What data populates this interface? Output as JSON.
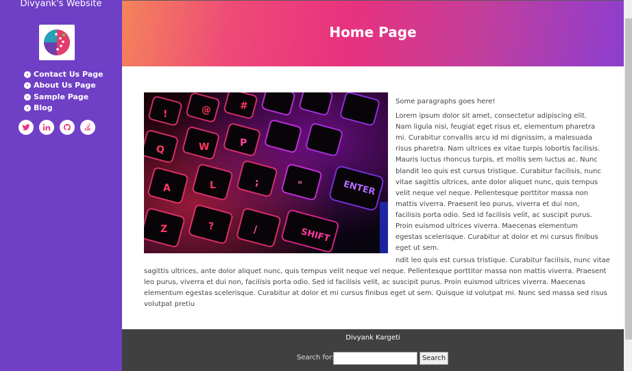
{
  "sidebar": {
    "site_title": "Divyank's Website",
    "logo_icon": "globe-dots-logo",
    "nav": [
      {
        "label": "Contact Us Page",
        "icon": "chevron-circle-right-icon"
      },
      {
        "label": "About Us Page",
        "icon": "chevron-circle-right-icon"
      },
      {
        "label": "Sample Page",
        "icon": "chevron-circle-right-icon"
      },
      {
        "label": "Blog",
        "icon": "chevron-circle-right-icon"
      }
    ],
    "social": [
      "twitter-icon",
      "linkedin-icon",
      "github-icon",
      "stackoverflow-icon"
    ]
  },
  "header": {
    "title": "Home Page"
  },
  "main": {
    "image_icon": "keyboard-photo",
    "intro": "Some paragraphs goes here!",
    "paragraph_right": "Lorem ipsum dolor sit amet, consectetur adipiscing elit. Nam ligula nisi, feugiat eget risus et, elementum pharetra mi. Curabitur convallis arcu id mi dignissim, a malesuada risus pharetra. Nam ultrices ex vitae turpis lobortis facilisis. Mauris luctus rhoncus turpis, et mollis sem luctus ac. Nunc blandit leo quis est cursus tristique. Curabitur facilisis, nunc vitae sagittis ultrices, ante dolor aliquet nunc, quis tempus velit neque vel neque. Pellentesque porttitor massa non mattis viverra. Praesent leo purus, viverra et dui non, facilisis porta odio. Sed id facilisis velit, ac suscipit purus. Proin euismod ultrices viverra. Maecenas elementum egestas scelerisque. Curabitur at dolor et mi cursus finibus eget ut sem.",
    "paragraph_bottom": "ndit leo quis est cursus tristique. Curabitur facilisis, nunc vitae sagittis ultrices, ante dolor aliquet nunc, quis tempus velit neque vel neque. Pellentesque porttitor massa non mattis viverra. Praesent leo purus, viverra et dui non, facilisis porta odio. Sed id facilisis velit, ac suscipit purus. Proin euismod ultrices viverra. Maecenas elementum egestas scelerisque. Curabitur at dolor et mi cursus finibus eget ut sem. Quisque id volutpat mi. Nunc sed massa sed risus volutpat pretiu"
  },
  "footer": {
    "name": "Divyank Kargeti",
    "search_label": "Search for:",
    "search_value": "",
    "search_button": "Search"
  },
  "colors": {
    "sidebar": "#6f3fc6",
    "footer": "#404040",
    "header_gradient_start": "#f4845a",
    "header_gradient_end": "#8c3ed0"
  }
}
